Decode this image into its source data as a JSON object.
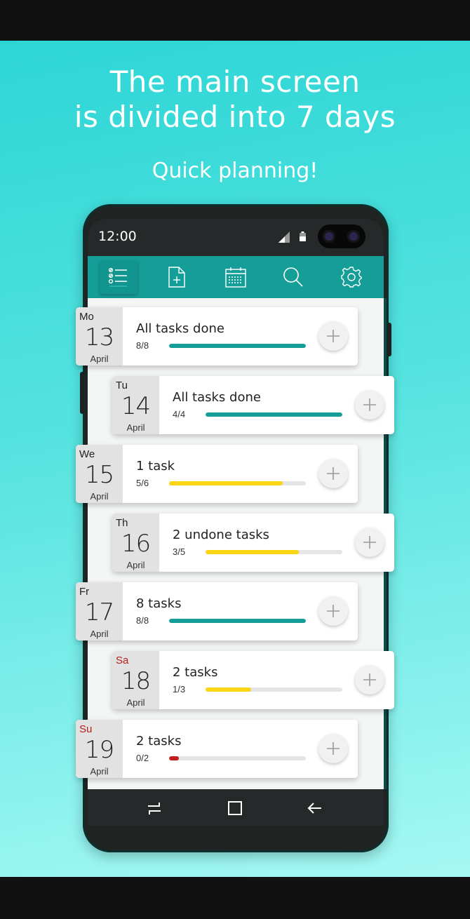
{
  "promo": {
    "headline_line1": "The main screen",
    "headline_line2": "is divided into 7 days",
    "subheadline": "Quick planning!"
  },
  "status_bar": {
    "time": "12:00",
    "icons": [
      "signal-icon",
      "battery-icon"
    ]
  },
  "toolbar": {
    "items": [
      {
        "icon": "task-list-icon",
        "active": true
      },
      {
        "icon": "new-document-icon",
        "active": false
      },
      {
        "icon": "calendar-icon",
        "active": false
      },
      {
        "icon": "search-icon",
        "active": false
      },
      {
        "icon": "settings-gear-icon",
        "active": false
      }
    ]
  },
  "days": [
    {
      "weekday": "Mo",
      "day": "13",
      "month": "April",
      "summary": "All tasks done",
      "count": "8/8",
      "progress": 1.0,
      "bar_color": "#159e97",
      "weekend": false
    },
    {
      "weekday": "Tu",
      "day": "14",
      "month": "April",
      "summary": "All tasks done",
      "count": "4/4",
      "progress": 1.0,
      "bar_color": "#159e97",
      "weekend": false
    },
    {
      "weekday": "We",
      "day": "15",
      "month": "April",
      "summary": "1 task",
      "count": "5/6",
      "progress": 0.833,
      "bar_color": "#f9d513",
      "weekend": false
    },
    {
      "weekday": "Th",
      "day": "16",
      "month": "April",
      "summary": "2 undone tasks",
      "count": "3/5",
      "progress": 0.68,
      "bar_color": "#f9d513",
      "weekend": false
    },
    {
      "weekday": "Fr",
      "day": "17",
      "month": "April",
      "summary": "8 tasks",
      "count": "8/8",
      "progress": 1.0,
      "bar_color": "#159e97",
      "weekend": false
    },
    {
      "weekday": "Sa",
      "day": "18",
      "month": "April",
      "summary": "2 tasks",
      "count": "1/3",
      "progress": 0.333,
      "bar_color": "#f9d513",
      "weekend": true
    },
    {
      "weekday": "Su",
      "day": "19",
      "month": "April",
      "summary": "2 tasks",
      "count": "0/2",
      "progress": 0.07,
      "bar_color": "#c0201d",
      "weekend": true
    }
  ],
  "navbar": {
    "items": [
      "recent-apps-icon",
      "home-icon",
      "back-icon"
    ]
  },
  "colors": {
    "accent": "#159e97",
    "partial": "#f9d513",
    "low": "#c0201d",
    "weekend_label": "#b3201d"
  }
}
